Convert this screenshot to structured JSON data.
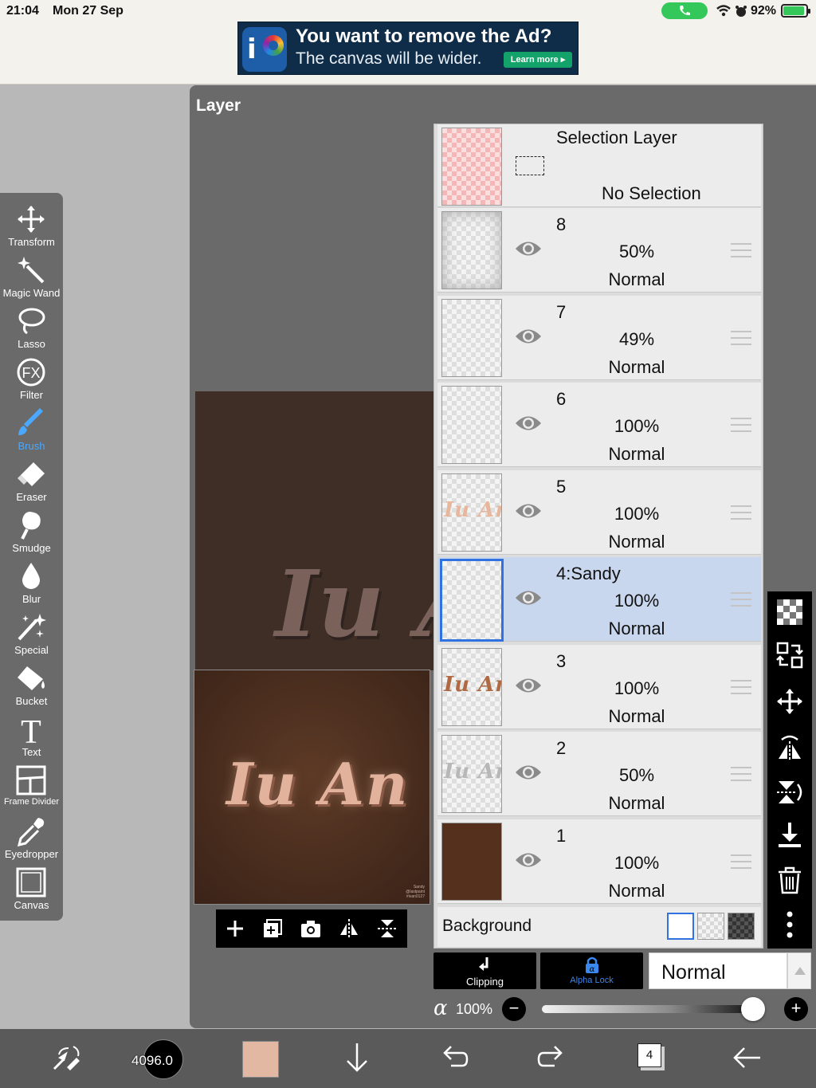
{
  "status_bar": {
    "time": "21:04",
    "date": "Mon 27 Sep",
    "battery": "92%",
    "battery_level": 0.92
  },
  "ad": {
    "headline": "You want to remove the Ad?",
    "subline": "The canvas will be wider.",
    "cta": "Learn more ▸"
  },
  "panel_title": "Layer",
  "tools": [
    {
      "label": "Transform",
      "icon": "transform-icon"
    },
    {
      "label": "Magic Wand",
      "icon": "magic-wand-icon"
    },
    {
      "label": "Lasso",
      "icon": "lasso-icon"
    },
    {
      "label": "Filter",
      "icon": "fx-icon"
    },
    {
      "label": "Brush",
      "icon": "brush-icon",
      "active": true
    },
    {
      "label": "Eraser",
      "icon": "eraser-icon"
    },
    {
      "label": "Smudge",
      "icon": "smudge-icon"
    },
    {
      "label": "Blur",
      "icon": "blur-drop-icon"
    },
    {
      "label": "Special",
      "icon": "special-icon"
    },
    {
      "label": "Bucket",
      "icon": "bucket-icon"
    },
    {
      "label": "Text",
      "icon": "text-icon"
    },
    {
      "label": "Frame Divider",
      "icon": "frame-divider-icon"
    },
    {
      "label": "Eyedropper",
      "icon": "eyedropper-icon"
    },
    {
      "label": "Canvas",
      "icon": "canvas-icon"
    }
  ],
  "artwork": {
    "text": "Iu An",
    "watermark": "Sandy\n@lastpaint\n#ivan0127"
  },
  "selection_layer": {
    "title": "Selection Layer",
    "status": "No Selection"
  },
  "layers": [
    {
      "name": "8",
      "opacity": "50%",
      "blend": "Normal",
      "thumb": "soft"
    },
    {
      "name": "7",
      "opacity": "49%",
      "blend": "Normal",
      "thumb": "empty"
    },
    {
      "name": "6",
      "opacity": "100%",
      "blend": "Normal",
      "thumb": "empty"
    },
    {
      "name": "5",
      "opacity": "100%",
      "blend": "Normal",
      "thumb": "text-light"
    },
    {
      "name": "4:Sandy",
      "opacity": "100%",
      "blend": "Normal",
      "thumb": "empty",
      "selected": true
    },
    {
      "name": "3",
      "opacity": "100%",
      "blend": "Normal",
      "thumb": "text-dark"
    },
    {
      "name": "2",
      "opacity": "50%",
      "blend": "Normal",
      "thumb": "text-grey"
    },
    {
      "name": "1",
      "opacity": "100%",
      "blend": "Normal",
      "thumb": "brown"
    }
  ],
  "background": {
    "label": "Background"
  },
  "layer_controls": {
    "clipping": "Clipping",
    "alpha_lock": "Alpha Lock",
    "blend_mode": "Normal",
    "alpha_symbol": "α",
    "opacity": "100%",
    "opacity_value": 1.0
  },
  "bottom_bar": {
    "brush_size": "4096.0",
    "color": "#e3b8a3",
    "pages": "4"
  }
}
